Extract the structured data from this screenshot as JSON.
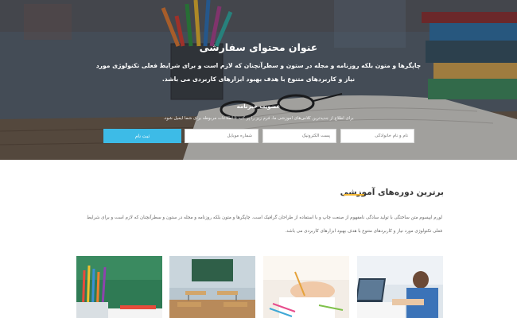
{
  "hero": {
    "title": "عنوان محتوای سفارشی",
    "text": "چاپگرها و متون بلکه روزنامه و مجله در ستون و سطرآنچنان که لازم است و برای شرایط فعلی تکنولوژی مورد نیاز و کاربردهای متنوع با هدف بهبود ابزارهای کاربردی می باشد."
  },
  "newsletter": {
    "title": "عضویت خبرنامه",
    "text": "برای اطلاع از جدیدترین کلاس‌های آموزشی ما، فرم زیر را پر کنید تا اطلاعات مربوطه برای شما ایمیل شود.",
    "name_placeholder": "نام و نام خانوادگی",
    "email_placeholder": "پست الکترونیک",
    "mobile_placeholder": "شماره موبایل",
    "submit_label": "ثبت نام"
  },
  "courses": {
    "title": "برترین دوره‌های آموزشی",
    "description": "لورم ایپسوم متن ساختگی با تولید سادگی نامفهوم از صنعت چاپ و با استفاده از طراحان گرافیک است. چاپگرها و متون بلکه روزنامه و مجله در ستون و سطرآنچنان که لازم است و برای شرایط فعلی تکنولوژی مورد نیاز و کاربردهای متنوع با هدف بهبود ابزارهای کاربردی می باشد."
  },
  "colors": {
    "accent": "#3dbbe7",
    "title_underline": "#f2b632"
  }
}
